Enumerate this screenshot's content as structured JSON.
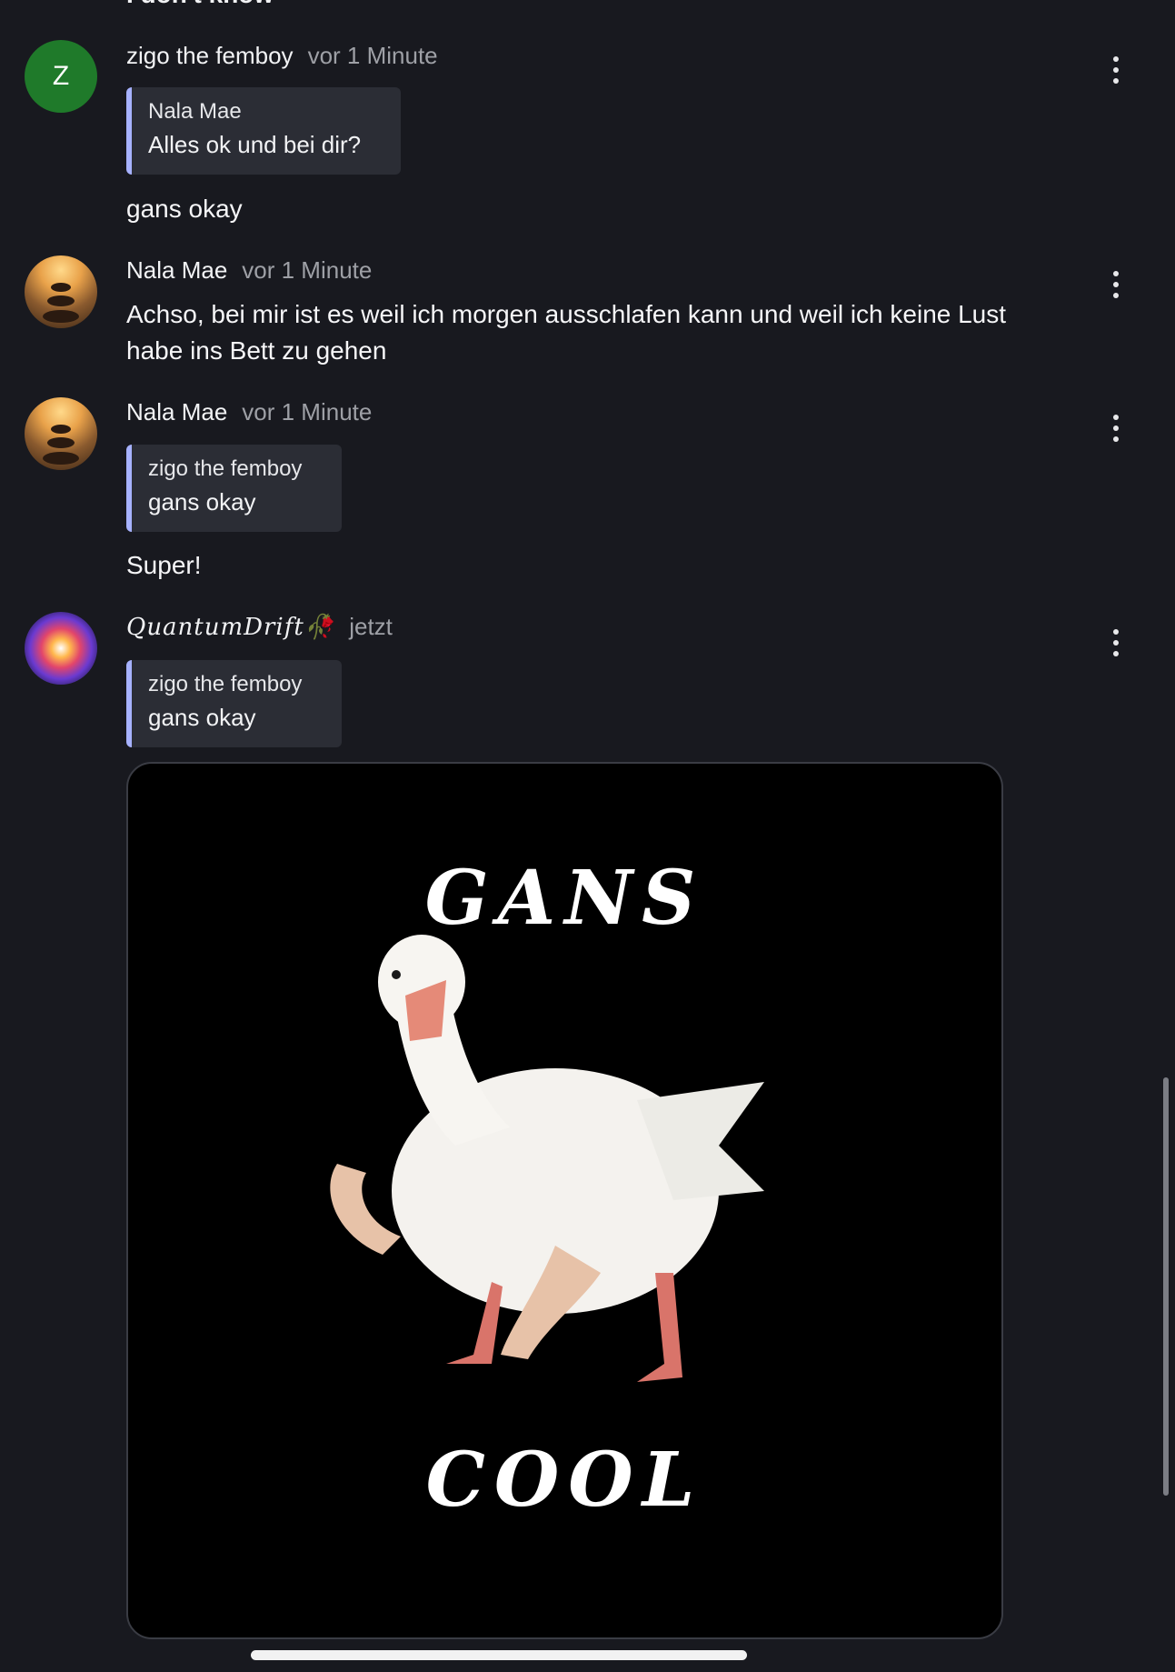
{
  "top_partial_text": "I don't know",
  "messages": [
    {
      "avatar_letter": "Z",
      "author": "zigo the femboy",
      "time": "vor 1 Minute",
      "quote": {
        "author": "Nala Mae",
        "text": "Alles ok und bei dir?"
      },
      "text": "gans okay"
    },
    {
      "author": "Nala Mae",
      "time": "vor 1 Minute",
      "text_line1": "Achso, bei mir ist es weil ich morgen ausschlafen kann und weil ich keine Lust",
      "text_line2": "habe ins Bett zu gehen"
    },
    {
      "author": "Nala Mae",
      "time": "vor 1 Minute",
      "quote": {
        "author": "zigo the femboy",
        "text": "gans okay"
      },
      "text": "Super!"
    },
    {
      "author": "QuantumDrift🥀",
      "time": "jetzt",
      "quote": {
        "author": "zigo the femboy",
        "text": "gans okay"
      },
      "image": {
        "top_text": "GANS",
        "bottom_text": "COOL"
      }
    }
  ],
  "colors": {
    "background": "#18191f",
    "quote_bg": "#2b2d35",
    "quote_accent": "#a7b2ff",
    "muted": "#9ea0a6",
    "avatar_z": "#1f7a2a"
  },
  "icons": [
    "more-vertical-icon",
    "avatar-image"
  ]
}
